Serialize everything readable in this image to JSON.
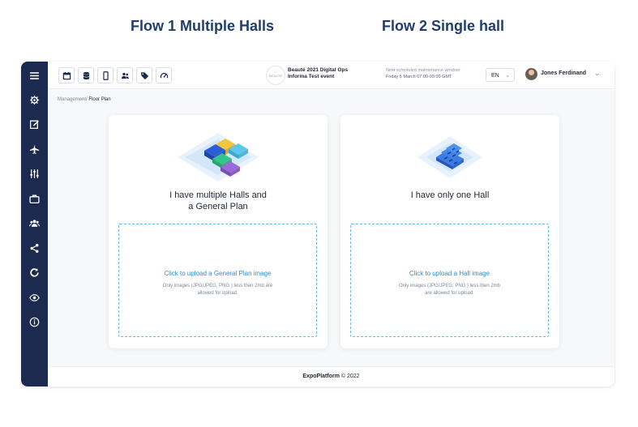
{
  "header": {
    "flow1_title": "Flow 1 Multiple Halls",
    "flow2_title": "Flow 2 Single hall"
  },
  "sidebar": {
    "items": [
      {
        "icon": "menu-icon"
      },
      {
        "icon": "settings-icon"
      },
      {
        "icon": "edit-icon"
      },
      {
        "icon": "plane-icon"
      },
      {
        "icon": "sliders-icon"
      },
      {
        "icon": "briefcase-icon"
      },
      {
        "icon": "people-icon"
      },
      {
        "icon": "share-icon"
      },
      {
        "icon": "refresh-icon"
      },
      {
        "icon": "eye-icon"
      },
      {
        "icon": "info-icon"
      }
    ]
  },
  "toolbar": {
    "icons": [
      "calendar-icon",
      "database-icon",
      "mobile-icon",
      "users-icon",
      "tag-icon",
      "gauge-icon"
    ],
    "event_logo_text": "BEAUTÉ",
    "event_line1": "Beauté 2021 Digital Ops",
    "event_line2": "Informa Test event",
    "maintenance_line1": "Next scheduled maintenance window:",
    "maintenance_line2": "Friday 5 March 07:00-09:00 GMT",
    "language": "EN",
    "user_name": "Jones Ferdinand"
  },
  "breadcrumb": {
    "parent": "Management/",
    "current": " Floor Plan"
  },
  "cards": {
    "multi": {
      "title_line1": "I have multiple Halls and",
      "title_line2": "a General Plan",
      "upload_link": "Click to upload a General Plan image",
      "upload_hint_line1": "Only images (JPG/JPEG, PNG ) less then 2mb are",
      "upload_hint_line2": "allowed for upload."
    },
    "single": {
      "title": "I have only one Hall",
      "upload_link": "Click to upload a Hall image",
      "upload_hint_line1": "Only images (JPG/JPEG, PNG ) less then 2mb",
      "upload_hint_line2": "are allowed for upload."
    }
  },
  "footer": {
    "brand": "ExpoPlatform",
    "copyright": " © 2022"
  },
  "colors": {
    "sidebar": "#1d2a4f",
    "title": "#213d6b",
    "link": "#2a8fcb",
    "dashed_border": "#6ab6dc"
  }
}
